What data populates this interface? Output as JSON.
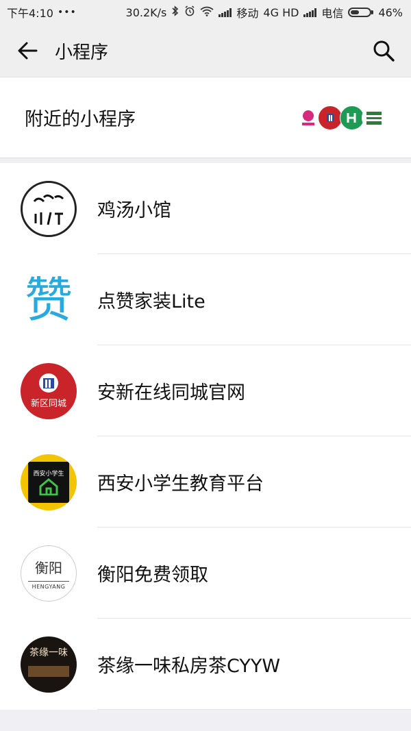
{
  "status": {
    "time": "下午4:10",
    "dots": "•••",
    "speed": "30.2K/s",
    "carrier1": "移动",
    "network": "4G HD",
    "carrier2": "电信",
    "battery": "46%",
    "battery_level": 0.46
  },
  "header": {
    "title": "小程序",
    "back_icon": "arrow-left-icon",
    "search_icon": "search-icon"
  },
  "nearby": {
    "label": "附近的小程序"
  },
  "items": [
    {
      "name": "鸡汤小馆",
      "icon": "鸡汤\n小馆"
    },
    {
      "name": "点赞家装Lite",
      "icon": "赞"
    },
    {
      "name": "安新在线同城官网",
      "icon": "新区同城"
    },
    {
      "name": "西安小学生教育平台",
      "icon": "西安小学生"
    },
    {
      "name": "衡阳免费领取",
      "icon": "衡阳",
      "icon_sub": "HENGYANG"
    },
    {
      "name": "茶缘一味私房茶CYYW",
      "icon": "茶缘一味"
    }
  ]
}
